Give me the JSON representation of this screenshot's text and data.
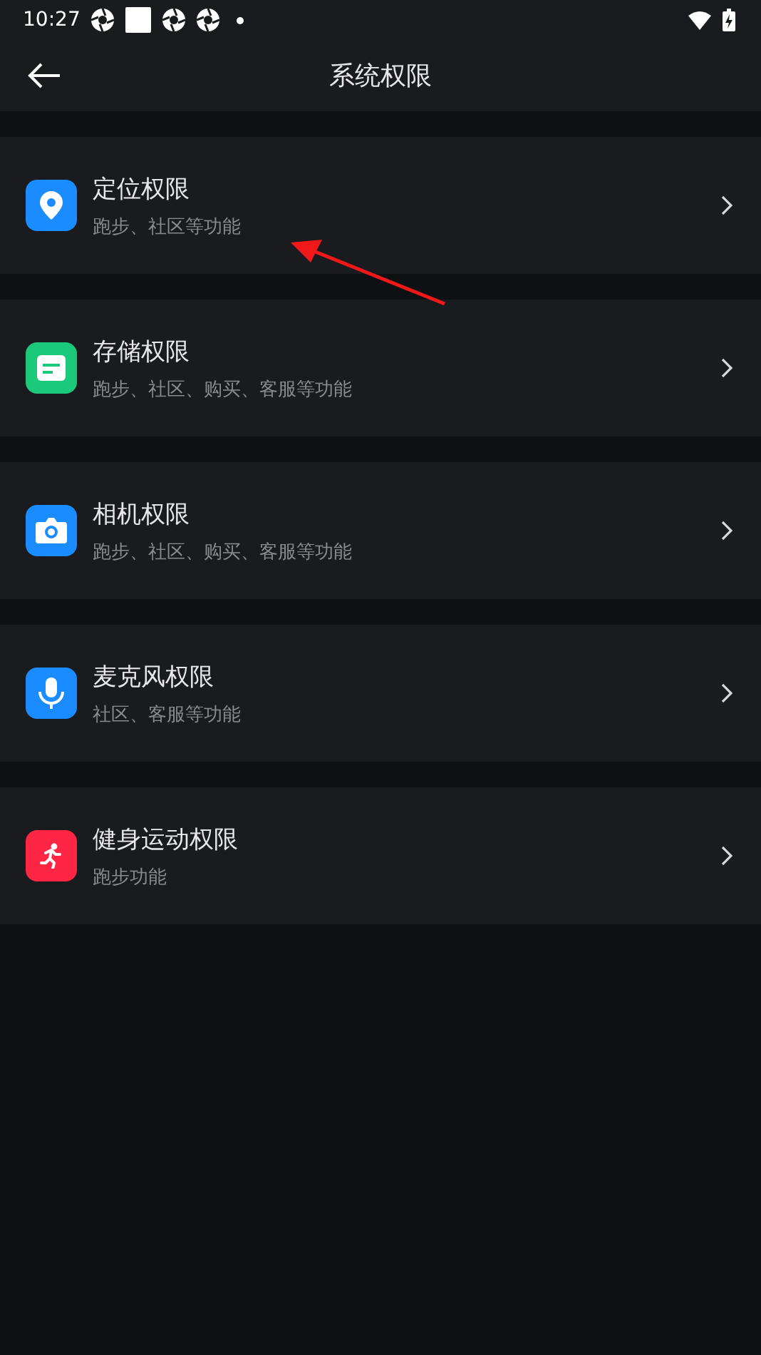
{
  "status_bar": {
    "time": "10:27"
  },
  "header": {
    "title": "系统权限"
  },
  "permissions": [
    {
      "kind": "location",
      "color": "#1a8cff",
      "title": "定位权限",
      "subtitle": "跑步、社区等功能"
    },
    {
      "kind": "storage",
      "color": "#1cc97a",
      "title": "存储权限",
      "subtitle": "跑步、社区、购买、客服等功能"
    },
    {
      "kind": "camera",
      "color": "#1a8cff",
      "title": "相机权限",
      "subtitle": "跑步、社区、购买、客服等功能"
    },
    {
      "kind": "mic",
      "color": "#1a8cff",
      "title": "麦克风权限",
      "subtitle": "社区、客服等功能"
    },
    {
      "kind": "fitness",
      "color": "#ff2545",
      "title": "健身运动权限",
      "subtitle": "跑步功能"
    }
  ]
}
